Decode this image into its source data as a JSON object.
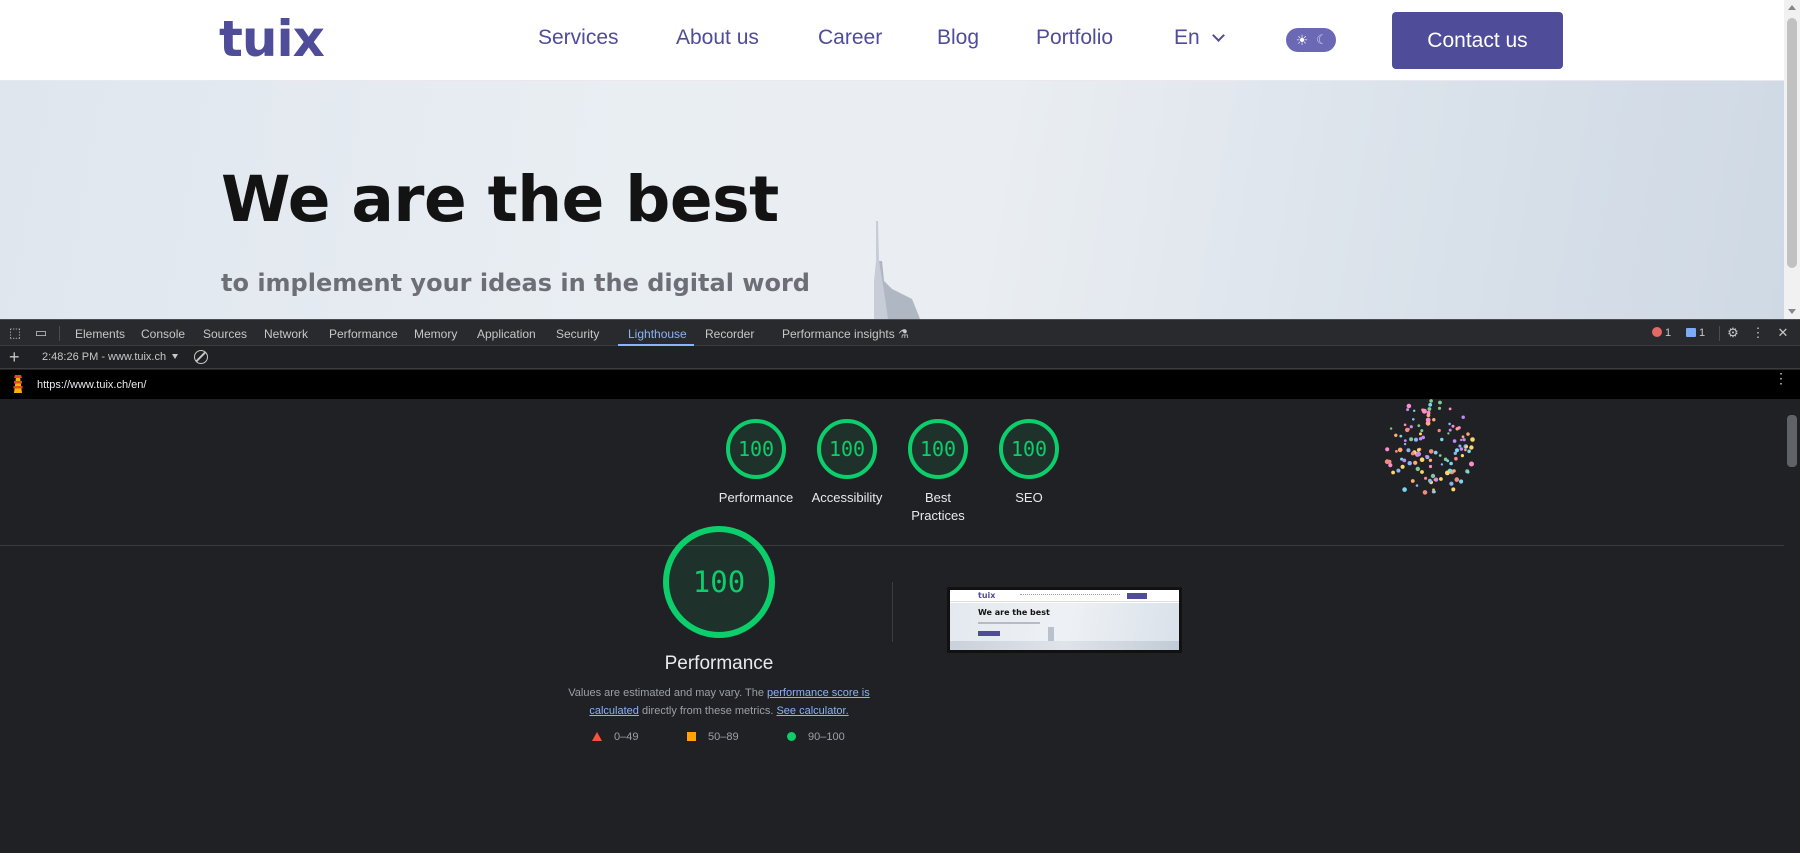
{
  "site": {
    "logo": "tuix",
    "nav": [
      "Services",
      "About us",
      "Career",
      "Blog",
      "Portfolio"
    ],
    "lang": "En",
    "contact": "Contact us",
    "hero_title": "We are the best",
    "hero_sub": "to implement your ideas in the digital word",
    "accent": "#4f4c99"
  },
  "devtools": {
    "tabs": [
      "Elements",
      "Console",
      "Sources",
      "Network",
      "Performance",
      "Memory",
      "Application",
      "Security",
      "Lighthouse",
      "Recorder",
      "Performance insights"
    ],
    "active_tab": "Lighthouse",
    "errors": "1",
    "messages": "1",
    "report_label": "2:48:26 PM - www.tuix.ch",
    "url": "https://www.tuix.ch/en/"
  },
  "lighthouse": {
    "scores": [
      {
        "label": "Performance",
        "value": "100"
      },
      {
        "label": "Accessibility",
        "value": "100"
      },
      {
        "label": "Best Practices",
        "value": "100"
      },
      {
        "label": "SEO",
        "value": "100"
      }
    ],
    "main_score": "100",
    "main_title": "Performance",
    "desc_prefix": "Values are estimated and may vary. The ",
    "desc_link1": "performance score is calculated",
    "desc_middle": " directly from these metrics. ",
    "desc_link2": "See calculator.",
    "legend": [
      "0–49",
      "50–89",
      "90–100"
    ],
    "pass_color": "#0cce6b",
    "average_color": "#ffa400",
    "fail_color": "#ff4e42",
    "thumb": {
      "logo": "tuix",
      "title": "We are the best"
    }
  }
}
